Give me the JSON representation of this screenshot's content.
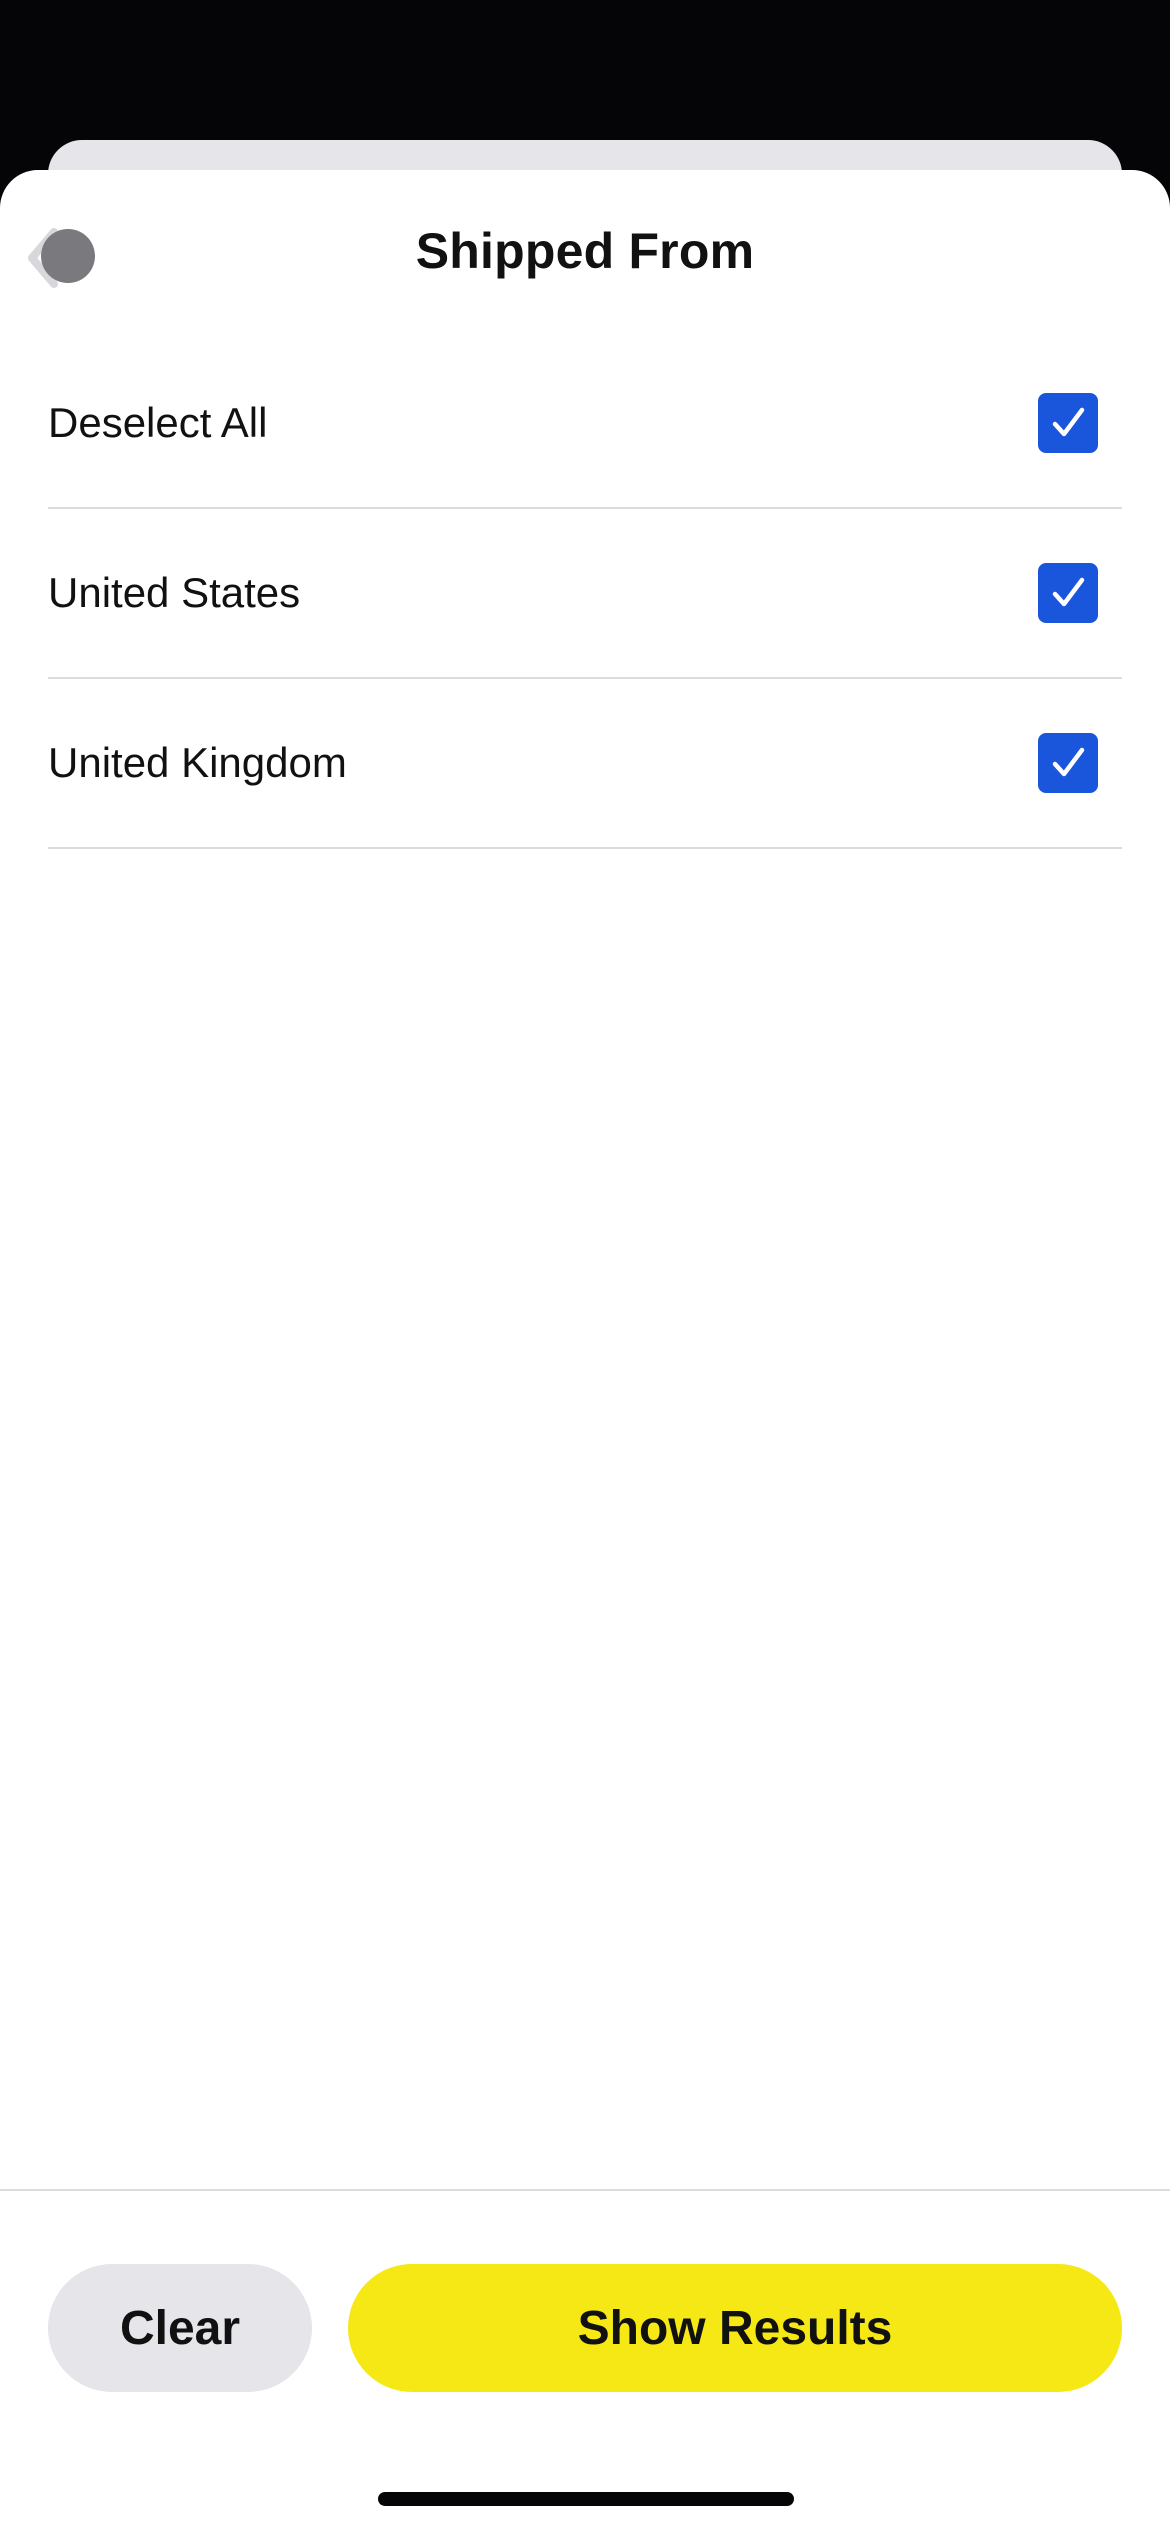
{
  "header": {
    "title": "Shipped From",
    "back_icon": "chevron-left-icon"
  },
  "options": [
    {
      "label": "Deselect All",
      "checked": true
    },
    {
      "label": "United States",
      "checked": true
    },
    {
      "label": "United Kingdom",
      "checked": true
    }
  ],
  "footer": {
    "clear_label": "Clear",
    "show_results_label": "Show Results"
  },
  "colors": {
    "accent_yellow": "#f5e814",
    "checkbox_blue": "#1a56db",
    "clear_gray": "#e5e5ea"
  }
}
